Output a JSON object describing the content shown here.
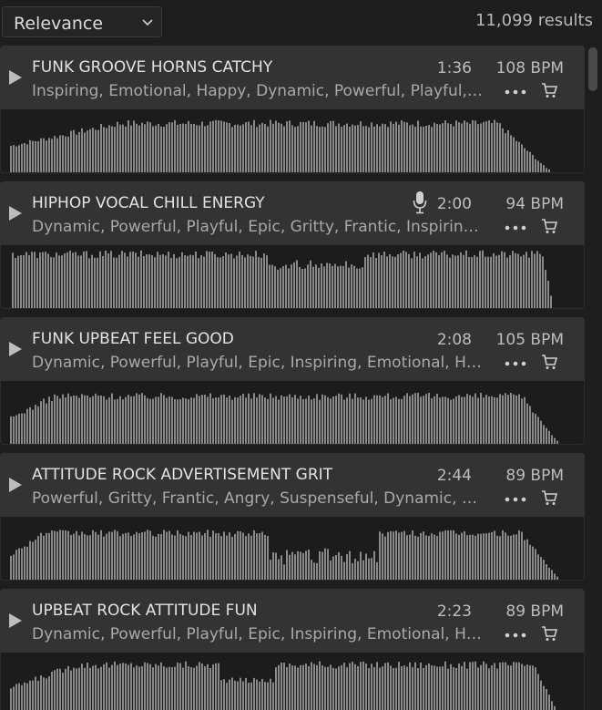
{
  "sort": {
    "label": "Relevance"
  },
  "results_count": "11,099 results",
  "colors": {
    "waveform": "#8a8a8a",
    "row_header": "#333333",
    "waveform_bg": "#1c1c1c"
  },
  "icons": {
    "play": "play-icon",
    "more": "more-icon",
    "cart": "cart-icon",
    "vocal": "microphone-icon",
    "sort_chevron": "chevron-down-icon"
  },
  "tracks": [
    {
      "title": "FUNK GROOVE HORNS CATCHY",
      "tags": "Inspiring, Emotional, Happy, Dynamic, Powerful, Playful, Epic, Gritty",
      "duration": "1:36",
      "bpm": "108 BPM",
      "vocal": false
    },
    {
      "title": "HIPHOP VOCAL CHILL ENERGY",
      "tags": "Dynamic, Powerful, Playful, Epic, Gritty, Frantic, Inspiring, Emotional",
      "duration": "2:00",
      "bpm": "94 BPM",
      "vocal": true
    },
    {
      "title": "FUNK UPBEAT FEEL GOOD",
      "tags": "Dynamic, Powerful, Playful, Epic, Inspiring, Emotional, Happy, Gritty",
      "duration": "2:08",
      "bpm": "105 BPM",
      "vocal": false
    },
    {
      "title": "ATTITUDE ROCK ADVERTISEMENT GRIT",
      "tags": "Powerful, Gritty, Frantic, Angry, Suspenseful, Dynamic, Rebellious",
      "duration": "2:44",
      "bpm": "89 BPM",
      "vocal": false
    },
    {
      "title": "UPBEAT ROCK ATTITUDE FUN",
      "tags": "Dynamic, Powerful, Playful, Epic, Inspiring, Emotional, Happy, Gritty",
      "duration": "2:23",
      "bpm": "89 BPM",
      "vocal": false
    }
  ]
}
